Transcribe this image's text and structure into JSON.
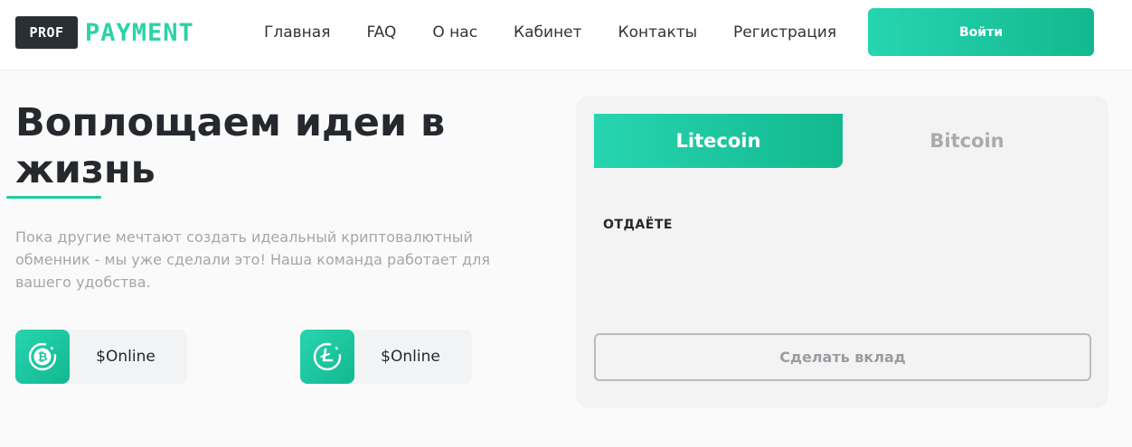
{
  "logo": {
    "prof": "PROF",
    "payment": "PAYMENT"
  },
  "nav": {
    "items": [
      "Главная",
      "FAQ",
      "О нас",
      "Кабинет",
      "Контакты",
      "Регистрация"
    ],
    "login_label": "Войти"
  },
  "hero": {
    "title": "Воплощаем идеи в жизнь",
    "description": "Пока другие мечтают создать идеальный криптовалютный обменник - мы уже сделали это! Наша команда работает для вашего удобства."
  },
  "stats": [
    {
      "icon": "bitcoin-icon",
      "label": "$Online"
    },
    {
      "icon": "litecoin-icon",
      "label": "$Online"
    }
  ],
  "exchange": {
    "tabs": [
      {
        "label": "Litecoin",
        "active": true
      },
      {
        "label": "Bitcoin",
        "active": false
      }
    ],
    "give_label": "ОТДАЁТЕ",
    "deposit_label": "Сделать вклад"
  },
  "colors": {
    "accent": "#21c9a0",
    "accent_gradient_start": "#26d5b0",
    "accent_gradient_end": "#13b88f",
    "dark": "#25282d",
    "muted_text": "#a3a6ab"
  }
}
